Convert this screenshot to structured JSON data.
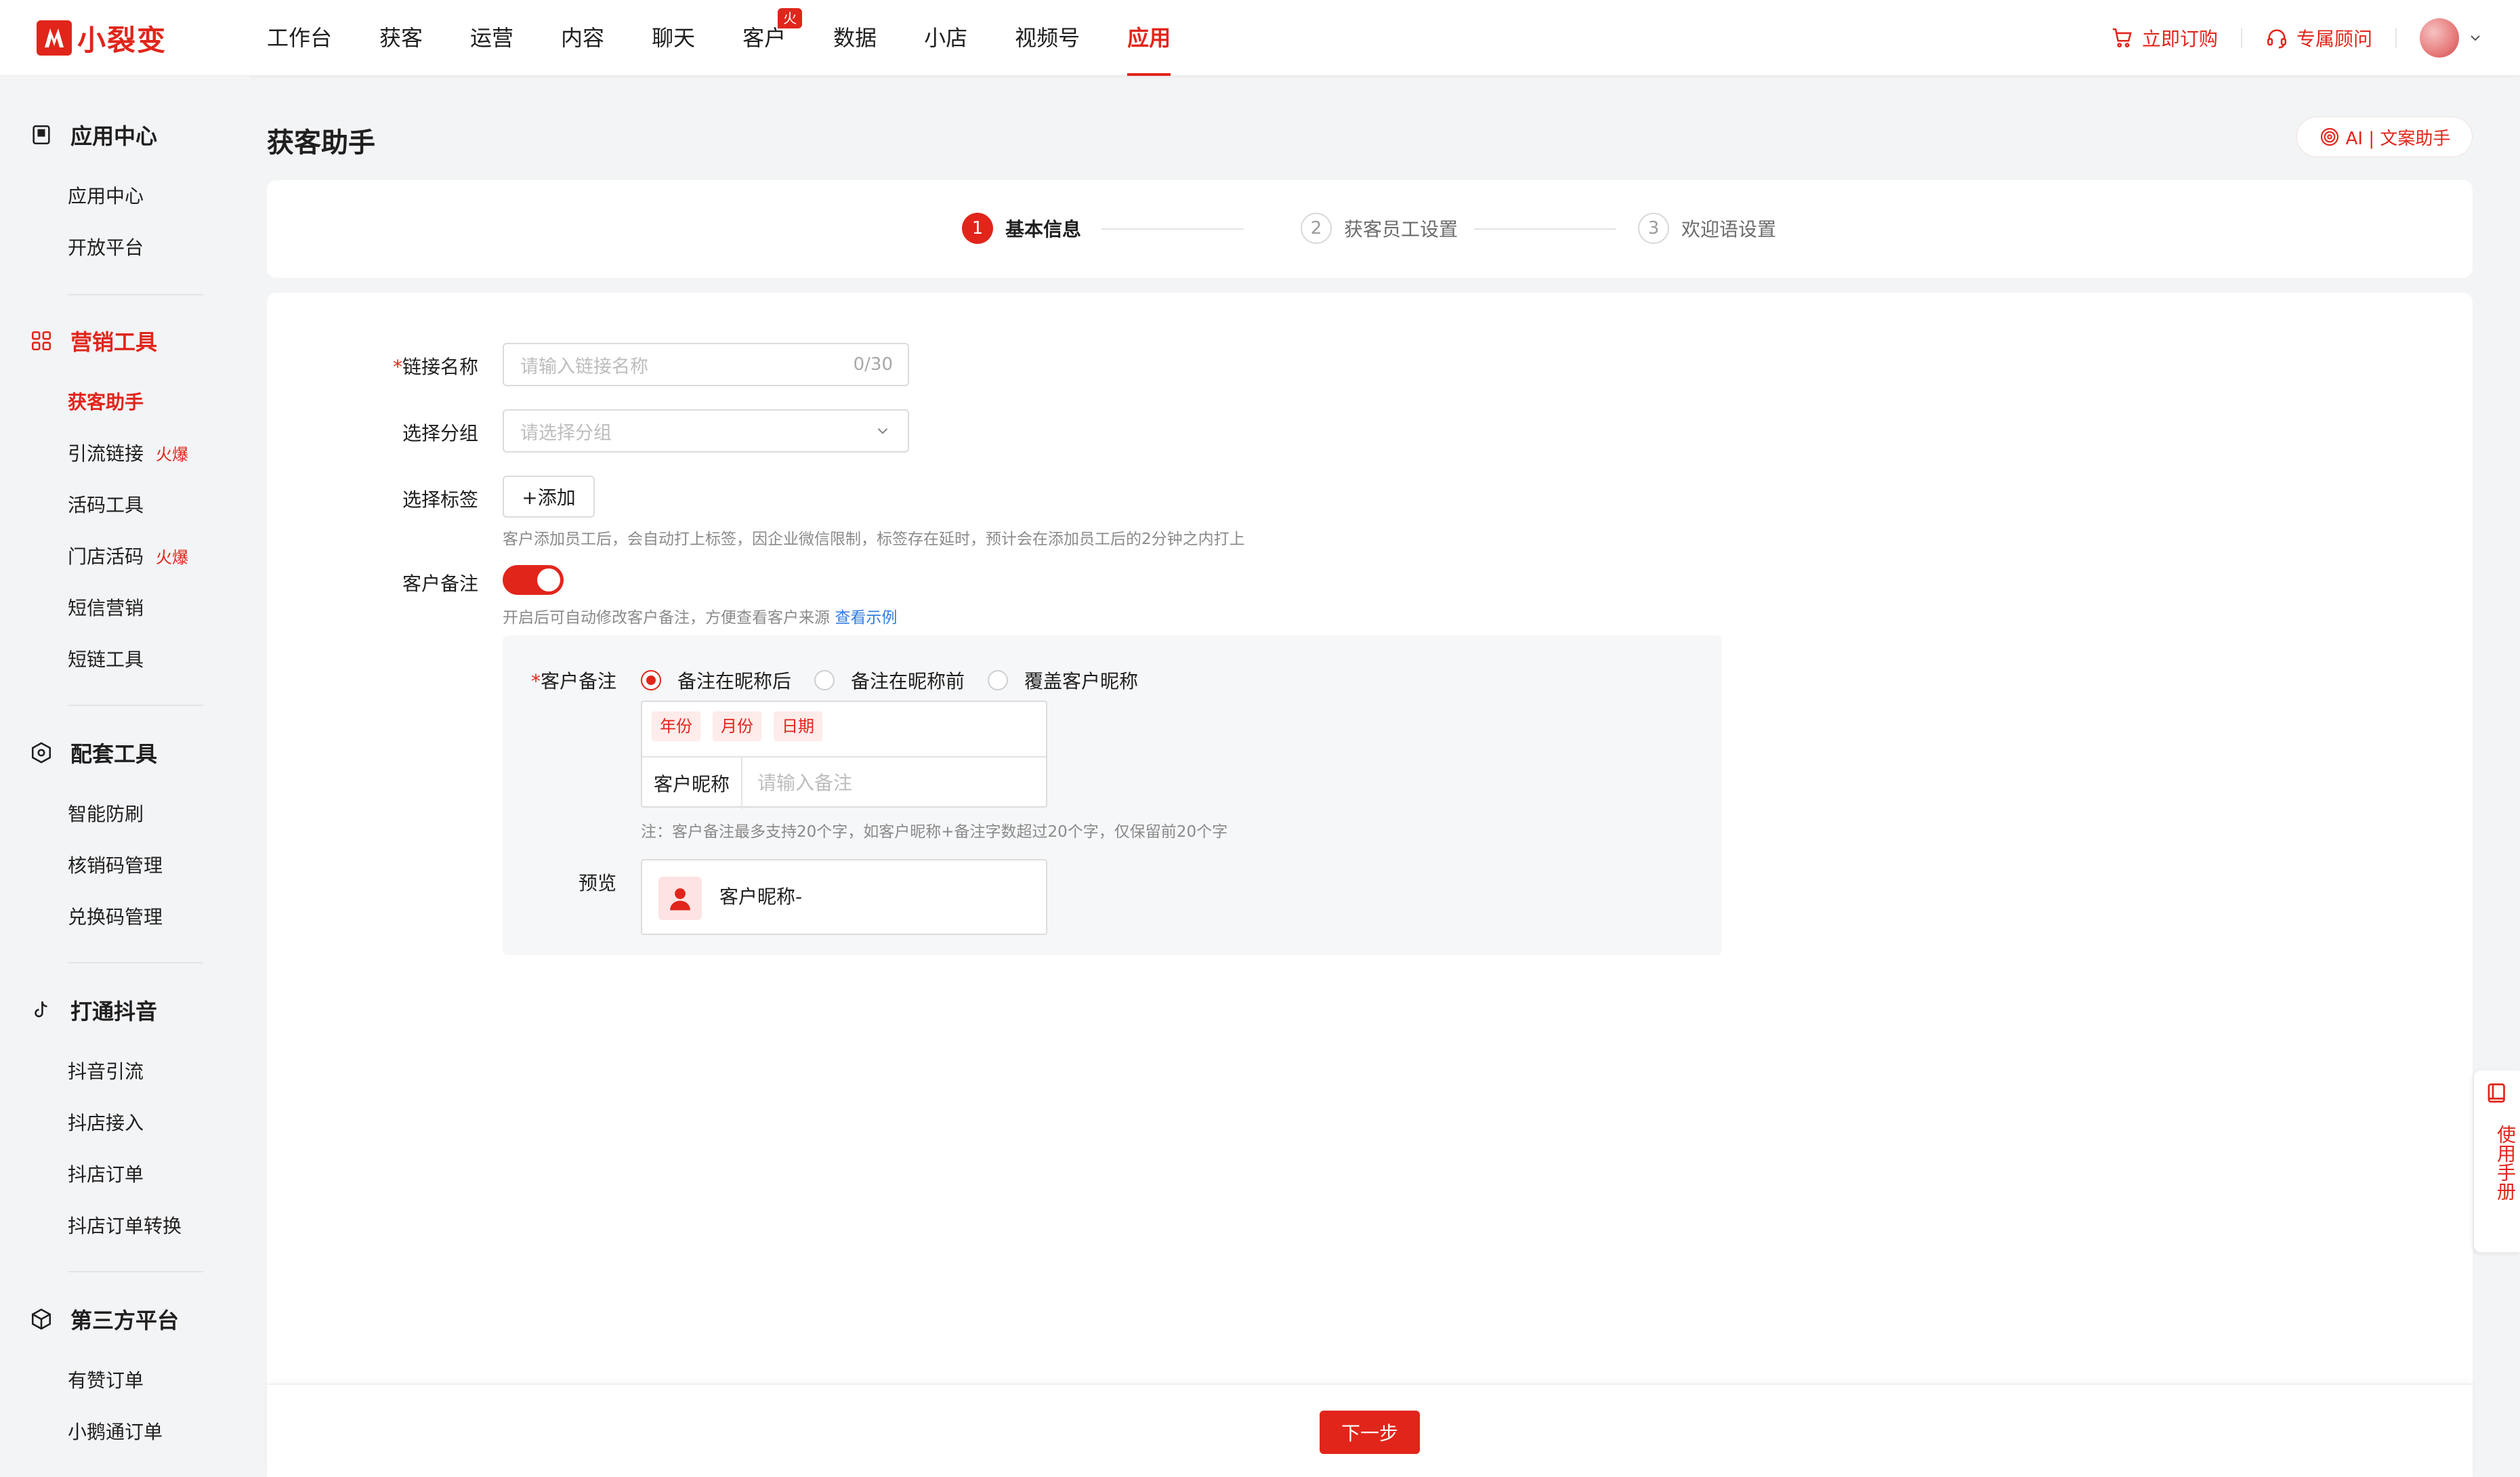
{
  "colors": {
    "brand": "#e1251b",
    "link": "#2f7de1",
    "bg": "#f3f4f6"
  },
  "header": {
    "logo_text": "小裂变",
    "nav": [
      {
        "label": "工作台"
      },
      {
        "label": "获客"
      },
      {
        "label": "运营"
      },
      {
        "label": "内容"
      },
      {
        "label": "聊天"
      },
      {
        "label": "客户",
        "badge": "火爆"
      },
      {
        "label": "数据"
      },
      {
        "label": "小店"
      },
      {
        "label": "视频号"
      },
      {
        "label": "应用",
        "active": true
      }
    ],
    "order_link": "立即订购",
    "advisor_link": "专属顾问",
    "icons": {
      "order": "cart-icon",
      "advisor": "headset-icon",
      "user": "avatar",
      "menu": "chevron-down-icon"
    }
  },
  "sidebar": {
    "groups": [
      {
        "title": "应用中心",
        "icon": "book-icon",
        "items": [
          {
            "label": "应用中心"
          },
          {
            "label": "开放平台"
          }
        ]
      },
      {
        "title": "营销工具",
        "icon": "grid-icon",
        "active": true,
        "items": [
          {
            "label": "获客助手",
            "active": true
          },
          {
            "label": "引流链接",
            "hot": "火爆"
          },
          {
            "label": "活码工具"
          },
          {
            "label": "门店活码",
            "hot": "火爆"
          },
          {
            "label": "短信营销"
          },
          {
            "label": "短链工具"
          }
        ]
      },
      {
        "title": "配套工具",
        "icon": "hexagon-icon",
        "items": [
          {
            "label": "智能防刷"
          },
          {
            "label": "核销码管理"
          },
          {
            "label": "兑换码管理"
          }
        ]
      },
      {
        "title": "打通抖音",
        "icon": "douyin-icon",
        "items": [
          {
            "label": "抖音引流"
          },
          {
            "label": "抖店接入"
          },
          {
            "label": "抖店订单"
          },
          {
            "label": "抖店订单转换"
          }
        ]
      },
      {
        "title": "第三方平台",
        "icon": "cube-icon",
        "items": [
          {
            "label": "有赞订单"
          },
          {
            "label": "小鹅通订单"
          }
        ]
      }
    ]
  },
  "page": {
    "title": "获客助手",
    "ai_button": "AI | 文案助手",
    "steps": [
      {
        "num": "1",
        "label": "基本信息",
        "state": "active"
      },
      {
        "num": "2",
        "label": "获客员工设置",
        "state": "todo"
      },
      {
        "num": "3",
        "label": "欢迎语设置",
        "state": "todo"
      }
    ]
  },
  "form": {
    "link_name": {
      "label": "链接名称",
      "required_mark": "*",
      "placeholder": "请输入链接名称",
      "counter": "0/30"
    },
    "group": {
      "label": "选择分组",
      "placeholder": "请选择分组"
    },
    "tags": {
      "label": "选择标签",
      "add_label": "+添加",
      "hint": "客户添加员工后，会自动打上标签，因企业微信限制，标签存在延时，预计会在添加员工后的2分钟之内打上"
    },
    "remark": {
      "label": "客户备注",
      "switch_on": true,
      "hint": "开启后可自动修改客户备注，方便查看客户来源",
      "hint_link": "查看示例",
      "sub_label": "客户备注",
      "required_mark": "*",
      "options": [
        {
          "label": "备注在昵称后",
          "checked": true
        },
        {
          "label": "备注在昵称前",
          "checked": false
        },
        {
          "label": "覆盖客户昵称",
          "checked": false
        }
      ],
      "chips": [
        "年份",
        "月份",
        "日期"
      ],
      "prefix": "客户昵称",
      "input_placeholder": "请输入备注",
      "note": "注：客户备注最多支持20个字，如客户昵称+备注字数超过20个字，仅保留前20个字",
      "preview_label": "预览",
      "preview_text": "客户昵称-"
    }
  },
  "footer": {
    "next_label": "下一步"
  },
  "manual": {
    "label": "使用手册",
    "icon": "manual-icon"
  }
}
